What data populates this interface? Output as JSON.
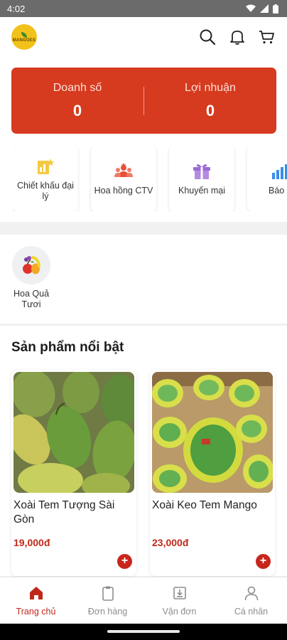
{
  "status_bar": {
    "time": "4:02"
  },
  "header": {
    "logo_text": "MANGOES"
  },
  "summary": {
    "sales_label": "Doanh số",
    "sales_value": "0",
    "profit_label": "Lợi nhuận",
    "profit_value": "0"
  },
  "quick_menu": [
    {
      "label": "Chiết khấu đại lý",
      "icon": "discount-chart-icon"
    },
    {
      "label": "Hoa hồng CTV",
      "icon": "team-commission-icon"
    },
    {
      "label": "Khuyến mại",
      "icon": "gift-icon"
    },
    {
      "label": "Báo c",
      "icon": "bar-chart-icon"
    }
  ],
  "categories": [
    {
      "label": "Hoa Quả Tươi",
      "icon": "fruit-icon"
    }
  ],
  "featured": {
    "title": "Sản phẩm nổi bật",
    "products": [
      {
        "name": "Xoài Tem Tượng Sài Gòn",
        "price": "19,000đ"
      },
      {
        "name": "Xoài Keo Tem Mango",
        "price": "23,000đ"
      }
    ]
  },
  "bottom_nav": [
    {
      "label": "Trang chủ",
      "active": true
    },
    {
      "label": "Đơn hàng",
      "active": false
    },
    {
      "label": "Vận đơn",
      "active": false
    },
    {
      "label": "Cá nhân",
      "active": false
    }
  ],
  "colors": {
    "brand": "#d63a1f",
    "price": "#c0281a",
    "logo": "#f2c21b"
  }
}
